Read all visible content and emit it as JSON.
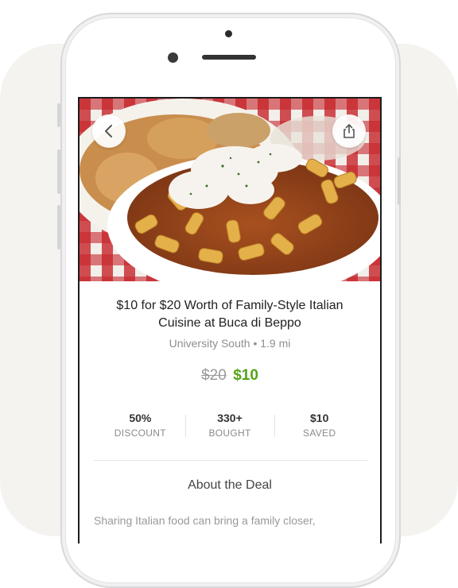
{
  "deal": {
    "title_line1": "$10 for $20 Worth of Family-Style Italian",
    "title_line2": "Cuisine at Buca di Beppo",
    "location": "University South • 1.9 mi",
    "original_price": "$20",
    "deal_price": "$10",
    "stats": [
      {
        "value": "50%",
        "label": "DISCOUNT"
      },
      {
        "value": "330+",
        "label": "BOUGHT"
      },
      {
        "value": "$10",
        "label": "SAVED"
      }
    ],
    "about_title": "About the Deal",
    "description": "Sharing Italian food can bring a family closer,"
  },
  "icons": {
    "back": "chevron-left-icon",
    "share": "share-icon"
  },
  "colors": {
    "accent_green": "#53a318",
    "text_dark": "#222222",
    "text_muted": "#8f8f8f"
  }
}
